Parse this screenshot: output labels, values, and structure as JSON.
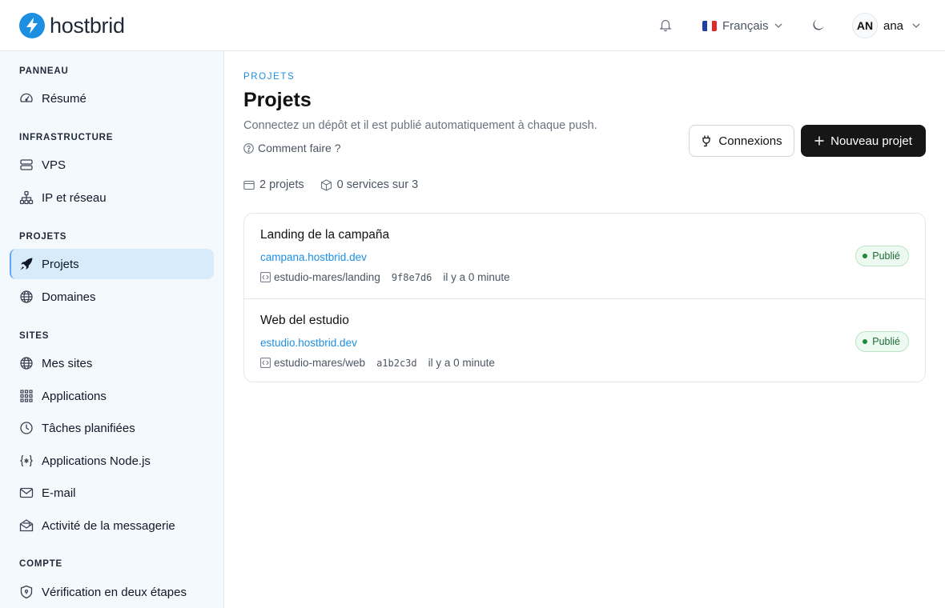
{
  "brand": {
    "name": "hostbrid",
    "color": "#1d8fe1"
  },
  "header": {
    "language": "Français",
    "user_initials": "AN",
    "user_name": "ana"
  },
  "sidebar": {
    "sections": [
      {
        "title": "PANNEAU",
        "items": [
          {
            "label": "Résumé",
            "icon": "gauge-icon"
          }
        ]
      },
      {
        "title": "INFRASTRUCTURE",
        "items": [
          {
            "label": "VPS",
            "icon": "server-icon"
          },
          {
            "label": "IP et réseau",
            "icon": "network-icon"
          }
        ]
      },
      {
        "title": "PROJETS",
        "items": [
          {
            "label": "Projets",
            "icon": "rocket-icon",
            "active": true
          },
          {
            "label": "Domaines",
            "icon": "globe-icon"
          }
        ]
      },
      {
        "title": "SITES",
        "items": [
          {
            "label": "Mes sites",
            "icon": "globe-icon"
          },
          {
            "label": "Applications",
            "icon": "grid-icon"
          },
          {
            "label": "Tâches planifiées",
            "icon": "clock-icon"
          },
          {
            "label": "Applications Node.js",
            "icon": "code-braces-icon"
          },
          {
            "label": "E-mail",
            "icon": "mail-icon"
          },
          {
            "label": "Activité de la messagerie",
            "icon": "mail-open-icon"
          }
        ]
      },
      {
        "title": "COMPTE",
        "items": [
          {
            "label": "Vérification en deux étapes",
            "icon": "shield-icon"
          }
        ]
      }
    ]
  },
  "main": {
    "eyebrow": "PROJETS",
    "title": "Projets",
    "subtitle": "Connectez un dépôt et il est publié automatiquement à chaque push.",
    "howto": "Comment faire ?",
    "connections_button": "Connexions",
    "new_project_button": "Nouveau projet",
    "stats": {
      "projects": "2 projets",
      "services": "0 services sur 3"
    },
    "projects": [
      {
        "name": "Landing de la campaña",
        "url": "campana.hostbrid.dev",
        "repo": "estudio-mares/landing",
        "commit": "9f8e7d6",
        "time": "il y a 0 minute",
        "status": "Publié"
      },
      {
        "name": "Web del estudio",
        "url": "estudio.hostbrid.dev",
        "repo": "estudio-mares/web",
        "commit": "a1b2c3d",
        "time": "il y a 0 minute",
        "status": "Publié"
      }
    ]
  },
  "colors": {
    "accent": "#1d8fe1",
    "sidebar_bg": "#f4f9fe",
    "active_item": "#d8ebfb",
    "status_green": "#1f8a3b"
  }
}
